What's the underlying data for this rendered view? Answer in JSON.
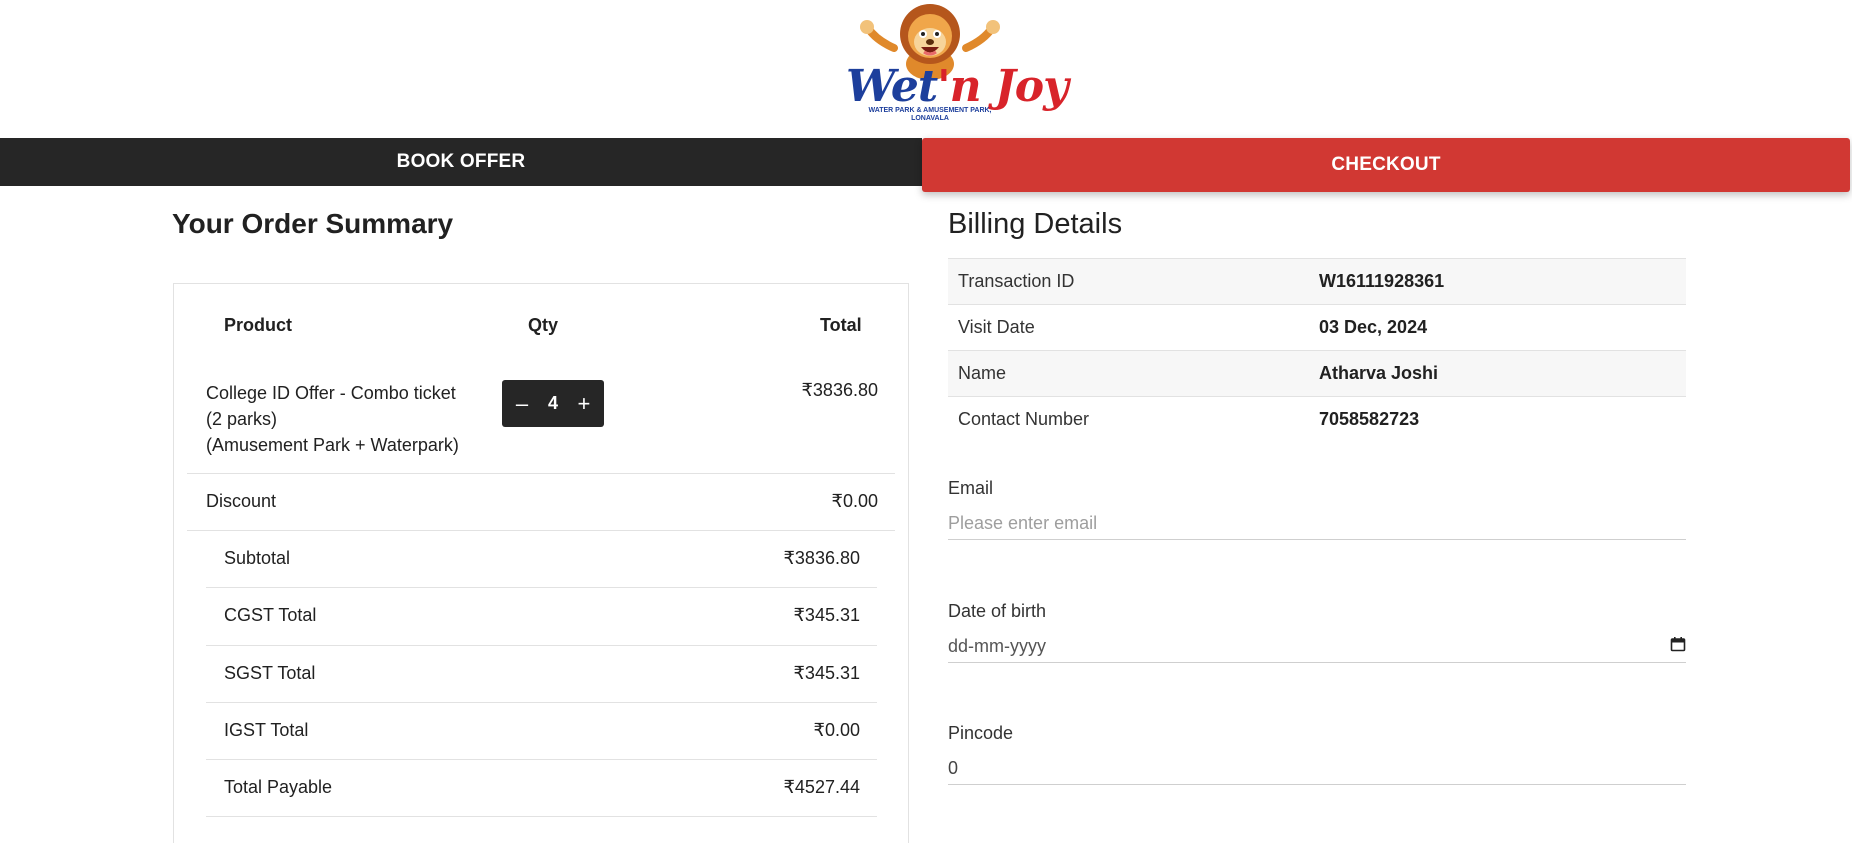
{
  "brand": {
    "name_part1": "Wet",
    "name_part2": "'n Joy",
    "tagline_line1": "WATER PARK & AMUSEMENT PARK,",
    "tagline_line2": "LONAVALA",
    "colors": {
      "blue": "#1d3f9c",
      "red": "#d8232a",
      "lion": "#e0892b"
    }
  },
  "steps": {
    "book_label": "BOOK OFFER",
    "checkout_label": "CHECKOUT",
    "book_color": "#262626",
    "checkout_color": "#d13833"
  },
  "order": {
    "title": "Your Order Summary",
    "columns": {
      "product": "Product",
      "qty": "Qty",
      "total": "Total"
    },
    "item": {
      "name_line1": "College ID Offer - Combo ticket",
      "name_line2": "(2 parks)",
      "name_line3": "(Amusement Park + Waterpark)",
      "qty": "4",
      "total": "₹3836.80"
    },
    "discount": {
      "label": "Discount",
      "value": "₹0.00"
    },
    "totals": [
      {
        "label": "Subtotal",
        "value": "₹3836.80"
      },
      {
        "label": "CGST Total",
        "value": "₹345.31"
      },
      {
        "label": "SGST Total",
        "value": "₹345.31"
      },
      {
        "label": "IGST Total",
        "value": "₹0.00"
      },
      {
        "label": "Total Payable",
        "value": "₹4527.44"
      }
    ]
  },
  "billing": {
    "title": "Billing Details",
    "rows": [
      {
        "label": "Transaction ID",
        "value": "W16111928361"
      },
      {
        "label": "Visit Date",
        "value": "03 Dec, 2024"
      },
      {
        "label": "Name",
        "value": "Atharva Joshi"
      },
      {
        "label": "Contact Number",
        "value": "7058582723"
      }
    ],
    "email": {
      "label": "Email",
      "placeholder": "Please enter email",
      "value": ""
    },
    "dob": {
      "label": "Date of birth",
      "placeholder": "dd-mm-yyyy"
    },
    "pincode": {
      "label": "Pincode",
      "value": "0"
    }
  }
}
